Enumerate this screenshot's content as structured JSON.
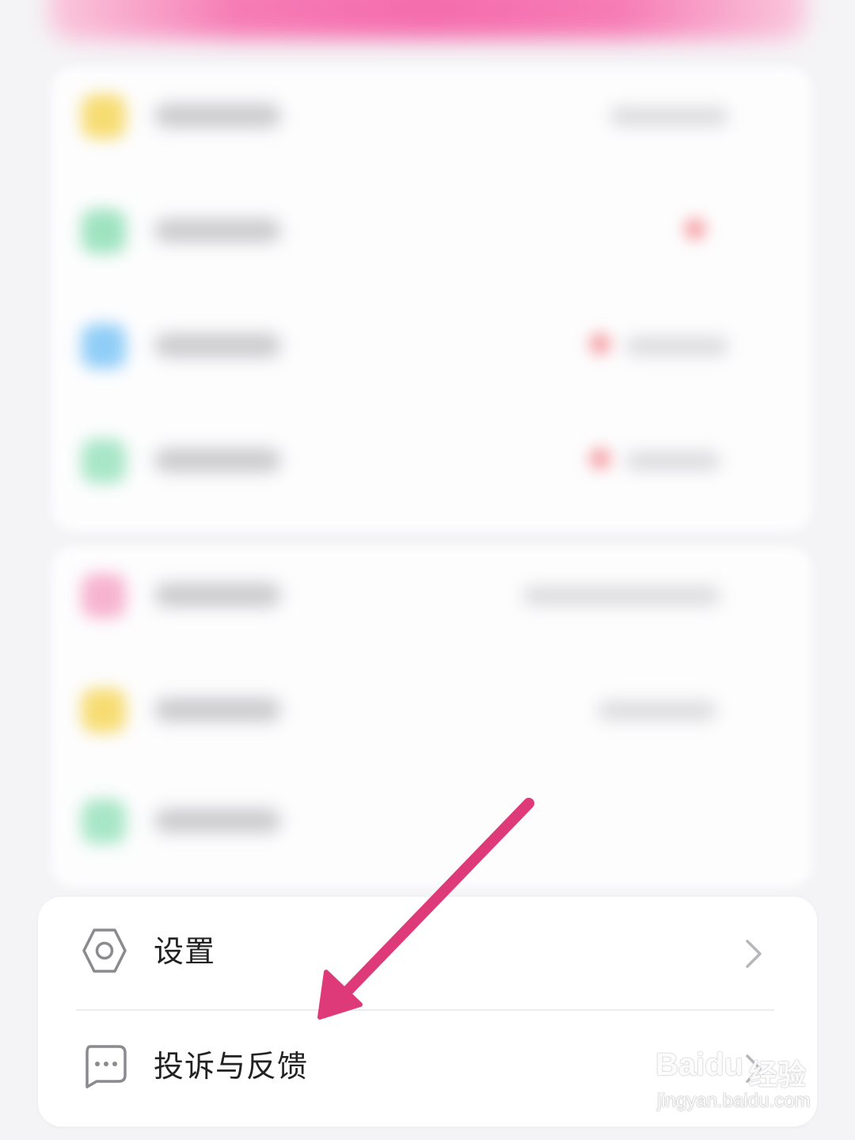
{
  "menu": {
    "items": [
      {
        "label": "设置",
        "icon": "settings-hexagon-icon"
      },
      {
        "label": "投诉与反馈",
        "icon": "chat-bubble-icon"
      }
    ]
  },
  "annotation": {
    "arrow_color": "#de3a7a"
  },
  "watermark": {
    "brand": "Baidu",
    "product": "经验",
    "url": "jingyan.baidu.com"
  },
  "colors": {
    "accent": "#f55ea6",
    "background": "#f4f4f6"
  }
}
